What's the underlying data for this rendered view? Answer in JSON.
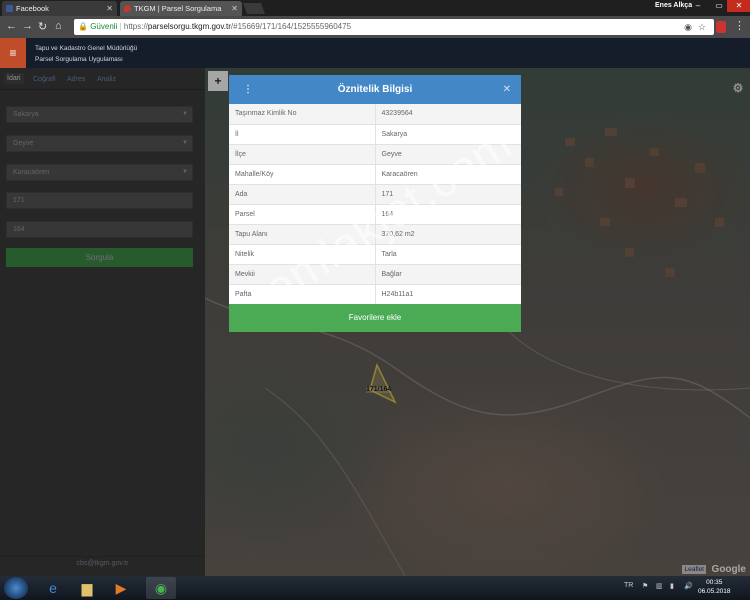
{
  "browser": {
    "tabs": [
      {
        "title": "Facebook",
        "favicon_color": "#3b5998"
      },
      {
        "title": "TKGM | Parsel Sorgulama",
        "favicon_color": "#c0392b"
      }
    ],
    "user": "Enes Alkça",
    "secure_label": "Güvenli",
    "url_scheme": "https://",
    "url_host": "parselsorgu.tkgm.gov.tr",
    "url_path": "/#15669/171/164/1525555960475"
  },
  "app": {
    "title_line1": "Tapu ve Kadastro Genel Müdürlüğü",
    "title_line2": "Parsel Sorgulama Uygulaması",
    "accent": "#c04d2a"
  },
  "sidebar": {
    "tabs": [
      "İdari",
      "Coğrafi",
      "Adres",
      "Analiz"
    ],
    "il": "Sakarya",
    "ilce": "Geyve",
    "mahalle": "Karacaören",
    "ada": "171",
    "parsel": "164",
    "sorgula_label": "Sorgula",
    "email": "cbs@tkgm.gov.tr"
  },
  "map": {
    "zoom_in": "+",
    "parcel_label": "171/164",
    "leaflet": "Leaflet",
    "google": "Google",
    "watermark": "emlakjet.com"
  },
  "modal": {
    "title": "Öznitelik Bilgisi",
    "rows": [
      {
        "key": "Taşınmaz Kimlik No",
        "value": "43239564"
      },
      {
        "key": "İl",
        "value": "Sakarya"
      },
      {
        "key": "İlçe",
        "value": "Geyve"
      },
      {
        "key": "Mahalle/Köy",
        "value": "Karacaören"
      },
      {
        "key": "Ada",
        "value": "171"
      },
      {
        "key": "Parsel",
        "value": "164"
      },
      {
        "key": "Tapu Alanı",
        "value": "370,62 m2"
      },
      {
        "key": "Nitelik",
        "value": "Tarla"
      },
      {
        "key": "Mevkii",
        "value": "Bağlar"
      },
      {
        "key": "Pafta",
        "value": "H24b11a1"
      }
    ],
    "favorite_label": "Favorilere ekle",
    "header_color": "#4487c6",
    "button_color": "#4bab54"
  },
  "taskbar": {
    "lang": "TR",
    "time": "00:35",
    "date": "06.05.2018"
  }
}
